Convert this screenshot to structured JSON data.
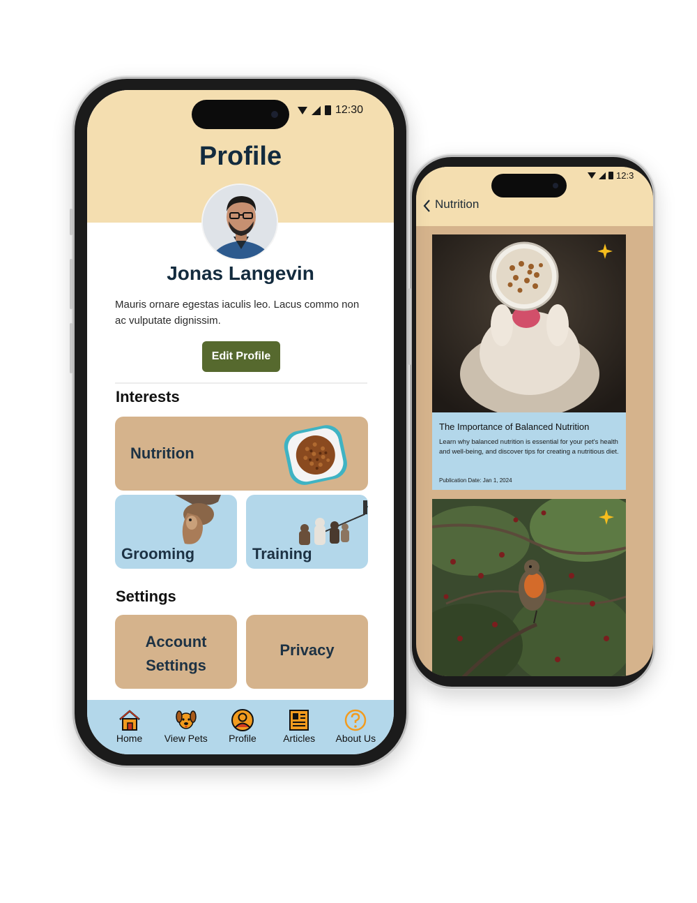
{
  "profile_screen": {
    "status": {
      "time": "12:30"
    },
    "title": "Profile",
    "user": {
      "name": "Jonas Langevin",
      "bio": "Mauris ornare egestas iaculis leo. Lacus commo non ac vulputate dignissim."
    },
    "edit_button_label": "Edit Profile",
    "interests": {
      "heading": "Interests",
      "items": [
        {
          "label": "Nutrition"
        },
        {
          "label": "Grooming"
        },
        {
          "label": "Training"
        }
      ]
    },
    "settings": {
      "heading": "Settings",
      "items": [
        {
          "label": "Account Settings"
        },
        {
          "label": "Privacy"
        }
      ]
    },
    "bottom_nav": [
      {
        "label": "Home",
        "icon": "home-icon"
      },
      {
        "label": "View Pets",
        "icon": "dog-icon"
      },
      {
        "label": "Profile",
        "icon": "user-icon"
      },
      {
        "label": "Articles",
        "icon": "newspaper-icon"
      },
      {
        "label": "About Us",
        "icon": "question-icon"
      }
    ]
  },
  "nutrition_screen": {
    "status": {
      "time": "12:3"
    },
    "nav_title": "Nutrition",
    "articles": [
      {
        "title": "The Importance of Balanced Nutrition",
        "description": "Learn why balanced nutrition is essential for your pet's health and well-being, and discover tips for creating a nutritious diet.",
        "date": "Publication Date: Jan 1, 2024"
      }
    ]
  },
  "colors": {
    "header_cream": "#f4deb0",
    "card_tan": "#d5b38c",
    "card_blue": "#b3d7ea",
    "button_green": "#56692e",
    "title_navy": "#132b3e",
    "star_yellow": "#f6bd1d"
  }
}
